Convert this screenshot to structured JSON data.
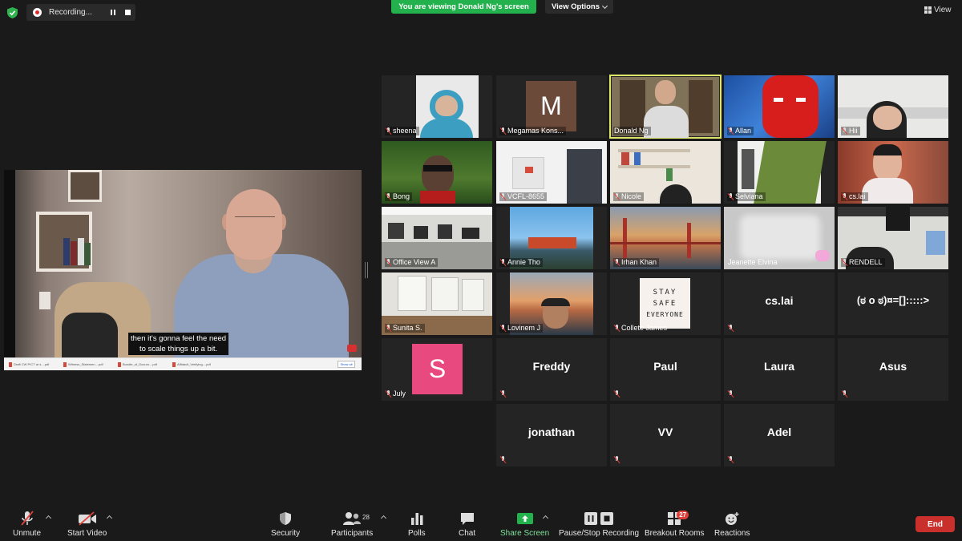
{
  "recording": {
    "label": "Recording..."
  },
  "banner": {
    "viewing": "You are viewing Donald Ng's screen",
    "view_options": "View Options"
  },
  "view_button": "View",
  "shared_screen": {
    "subtitle_line1": "then it's gonna feel the need",
    "subtitle_line2": "to scale things up a bit.",
    "downloads": [
      "Draft CW PICT ar s....pdf",
      "Witness_Statemen....pdf",
      "Bundle_of_Docum....pdf",
      "Affidavit_Verifying....pdf"
    ],
    "show_all": "Show all"
  },
  "participants": [
    {
      "name": "sheena",
      "type": "video",
      "muted": true
    },
    {
      "name": "Megamas Kons...",
      "type": "avatar",
      "initial": "M",
      "avatar_color": "#6b4a3a",
      "muted": true
    },
    {
      "name": "Donald Ng",
      "type": "video",
      "muted": false,
      "active": true
    },
    {
      "name": "Allan",
      "type": "video",
      "muted": true
    },
    {
      "name": "Hii",
      "type": "video",
      "muted": true
    },
    {
      "name": "Bong",
      "type": "video",
      "muted": true
    },
    {
      "name": "VCFL-8655",
      "type": "video",
      "muted": true
    },
    {
      "name": "Nicole",
      "type": "video",
      "muted": true
    },
    {
      "name": "Selviana",
      "type": "video",
      "muted": true
    },
    {
      "name": "cs.lai",
      "type": "video",
      "muted": true
    },
    {
      "name": "Office View A",
      "type": "video",
      "muted": true
    },
    {
      "name": "Annie Tho",
      "type": "video",
      "muted": true
    },
    {
      "name": "Irhan Khan",
      "type": "video",
      "muted": true
    },
    {
      "name": "Jeanette Elvina",
      "type": "video",
      "muted": false
    },
    {
      "name": "RENDELL",
      "type": "video",
      "muted": true
    },
    {
      "name": "Sunita S.",
      "type": "video",
      "muted": true
    },
    {
      "name": "Lovinem J",
      "type": "video",
      "muted": true
    },
    {
      "name": "Collete James",
      "type": "video",
      "muted": true,
      "sign": [
        "STAY",
        "SAFE",
        "EVERYONE"
      ]
    },
    {
      "name": "cs.lai",
      "type": "name",
      "muted": true
    },
    {
      "name": "(ಠ o ಠ)¤=[]:::::>",
      "type": "name",
      "muted": false
    },
    {
      "name": "July",
      "type": "avatar",
      "initial": "S",
      "avatar_color": "#e84a7f",
      "muted": true
    },
    {
      "name": "Freddy",
      "type": "name",
      "muted": true
    },
    {
      "name": "Paul",
      "type": "name",
      "muted": true
    },
    {
      "name": "Laura",
      "type": "name",
      "muted": true
    },
    {
      "name": "Asus",
      "type": "name",
      "muted": true
    },
    {
      "name": "jonathan",
      "type": "name",
      "muted": true
    },
    {
      "name": "VV",
      "type": "name",
      "muted": true
    },
    {
      "name": "Adel",
      "type": "name",
      "muted": true
    }
  ],
  "toolbar": {
    "unmute": "Unmute",
    "start_video": "Start Video",
    "security": "Security",
    "participants": "Participants",
    "participants_count": "28",
    "polls": "Polls",
    "chat": "Chat",
    "share_screen": "Share Screen",
    "pause_stop_recording": "Pause/Stop Recording",
    "breakout_rooms": "Breakout Rooms",
    "breakout_badge": "27",
    "reactions": "Reactions",
    "end": "End"
  },
  "colors": {
    "accent_green": "#23b14d",
    "end_red": "#c9302c",
    "active_speaker": "#dde66a",
    "muted_red": "#e0403a"
  }
}
